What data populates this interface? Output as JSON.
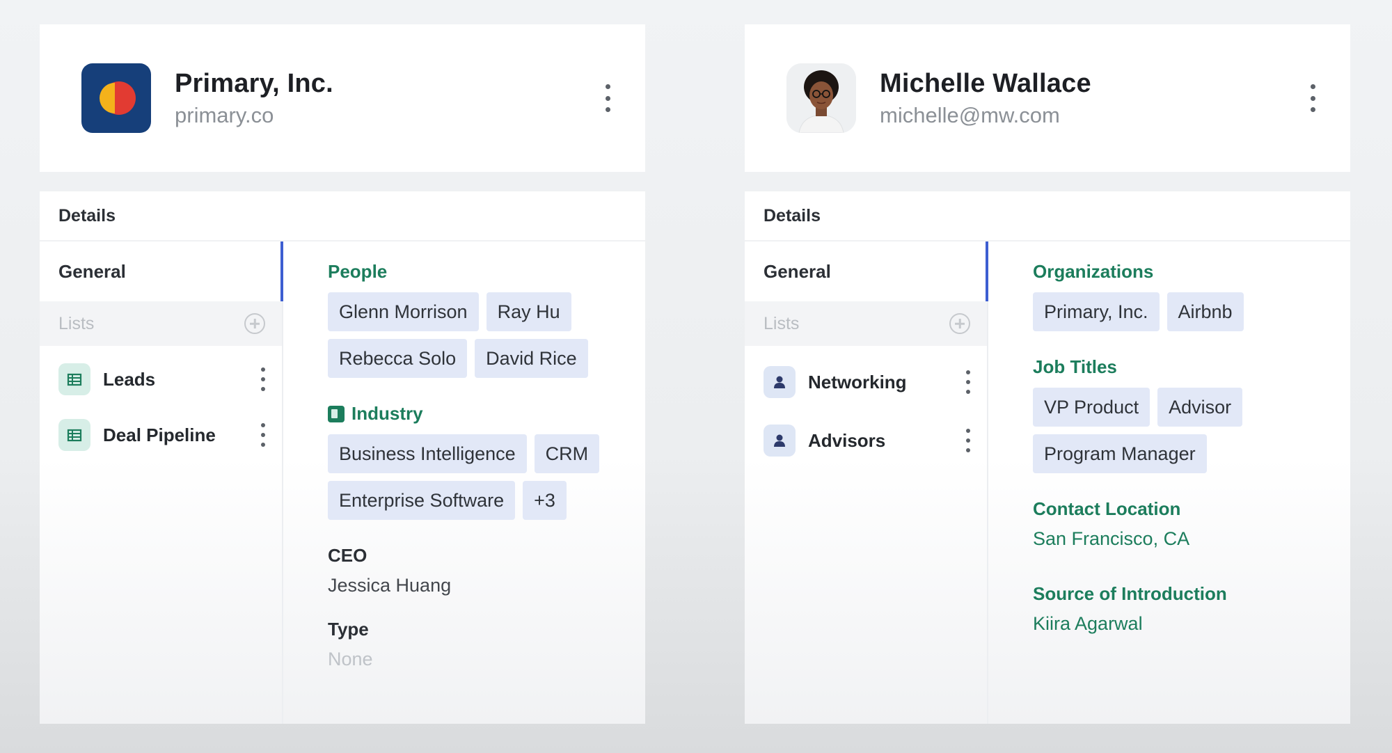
{
  "company": {
    "name": "Primary, Inc.",
    "domain": "primary.co",
    "details_title": "Details",
    "nav_general": "General",
    "nav_lists": "Lists",
    "lists": [
      {
        "label": "Leads",
        "icon": "table-icon"
      },
      {
        "label": "Deal Pipeline",
        "icon": "table-icon"
      }
    ],
    "people_title": "People",
    "people": [
      "Glenn Morrison",
      "Ray Hu",
      "Rebecca Solo",
      "David Rice"
    ],
    "industry_title": "Industry",
    "industries": [
      "Business Intelligence",
      "CRM",
      "Enterprise Software",
      "+3"
    ],
    "ceo_title": "CEO",
    "ceo_value": "Jessica Huang",
    "type_title": "Type",
    "type_value": "None"
  },
  "person": {
    "name": "Michelle Wallace",
    "email": "michelle@mw.com",
    "details_title": "Details",
    "nav_general": "General",
    "nav_lists": "Lists",
    "lists": [
      {
        "label": "Networking",
        "icon": "person-icon"
      },
      {
        "label": "Advisors",
        "icon": "person-icon"
      }
    ],
    "orgs_title": "Organizations",
    "orgs": [
      "Primary, Inc.",
      "Airbnb"
    ],
    "jobs_title": "Job Titles",
    "jobs": [
      "VP Product",
      "Advisor",
      "Program Manager"
    ],
    "location_title": "Contact Location",
    "location_value": "San Francisco, CA",
    "source_title": "Source of Introduction",
    "source_value": "Kiira Agarwal"
  },
  "colors": {
    "accent_green": "#1c7d5c",
    "accent_blue": "#3d5ed1",
    "chip_bg": "#e2e8f7",
    "logo_bg": "#163f7a",
    "logo_red": "#e23b32",
    "logo_yellow": "#f4b21b"
  }
}
